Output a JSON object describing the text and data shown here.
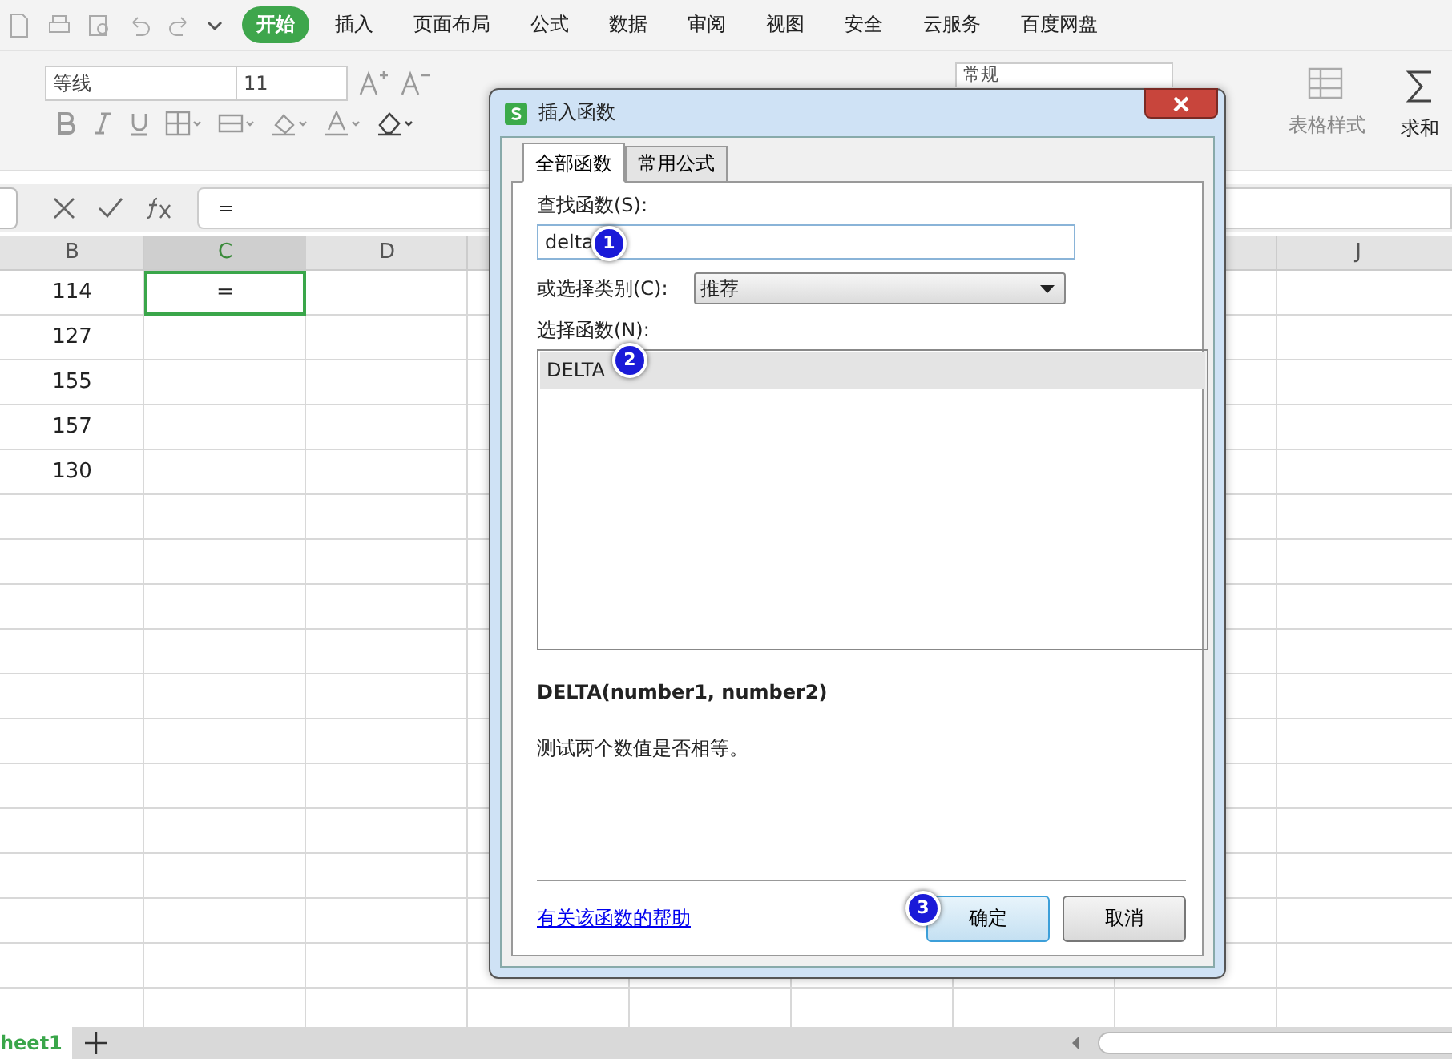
{
  "menu_tabs": [
    {
      "label": "开始",
      "selected": true
    },
    {
      "label": "插入",
      "selected": false
    },
    {
      "label": "页面布局",
      "selected": false
    },
    {
      "label": "公式",
      "selected": false
    },
    {
      "label": "数据",
      "selected": false
    },
    {
      "label": "审阅",
      "selected": false
    },
    {
      "label": "视图",
      "selected": false
    },
    {
      "label": "安全",
      "selected": false
    },
    {
      "label": "云服务",
      "selected": false
    },
    {
      "label": "百度网盘",
      "selected": false
    }
  ],
  "toolbar": {
    "font_name": "等线",
    "font_size": "11",
    "number_format": "常规",
    "table_style": "表格样式",
    "sum": "求和"
  },
  "formula_bar": {
    "value": "="
  },
  "columns": [
    {
      "label": "B",
      "selected": false
    },
    {
      "label": "C",
      "selected": true
    },
    {
      "label": "D",
      "selected": false
    },
    {
      "label": "J",
      "selected": false
    }
  ],
  "rows": [
    {
      "cells": [
        {
          "text": "114",
          "selected": false
        },
        {
          "text": "=",
          "selected": true
        }
      ]
    },
    {
      "cells": [
        {
          "text": "127",
          "selected": false
        }
      ]
    },
    {
      "cells": [
        {
          "text": "155",
          "selected": false
        }
      ]
    },
    {
      "cells": [
        {
          "text": "157",
          "selected": false
        }
      ]
    },
    {
      "cells": [
        {
          "text": "130",
          "selected": false
        }
      ]
    }
  ],
  "sheet_tab": "heet1",
  "dialog": {
    "title": "插入函数",
    "tabs": [
      {
        "label": "全部函数",
        "selected": true
      },
      {
        "label": "常用公式",
        "selected": false
      }
    ],
    "search_label": "查找函数(S):",
    "search_value": "delta",
    "category_label": "或选择类别(C):",
    "category_value": "推荐",
    "list_label": "选择函数(N):",
    "functions": [
      {
        "name": "DELTA",
        "selected": true
      }
    ],
    "syntax": "DELTA(number1, number2)",
    "description": "测试两个数值是否相等。",
    "help_link": "有关该函数的帮助",
    "buttons": [
      {
        "label": "确定",
        "kind": "default"
      },
      {
        "label": "取消",
        "kind": "normal"
      }
    ]
  },
  "step_badges": [
    "1",
    "2",
    "3"
  ]
}
